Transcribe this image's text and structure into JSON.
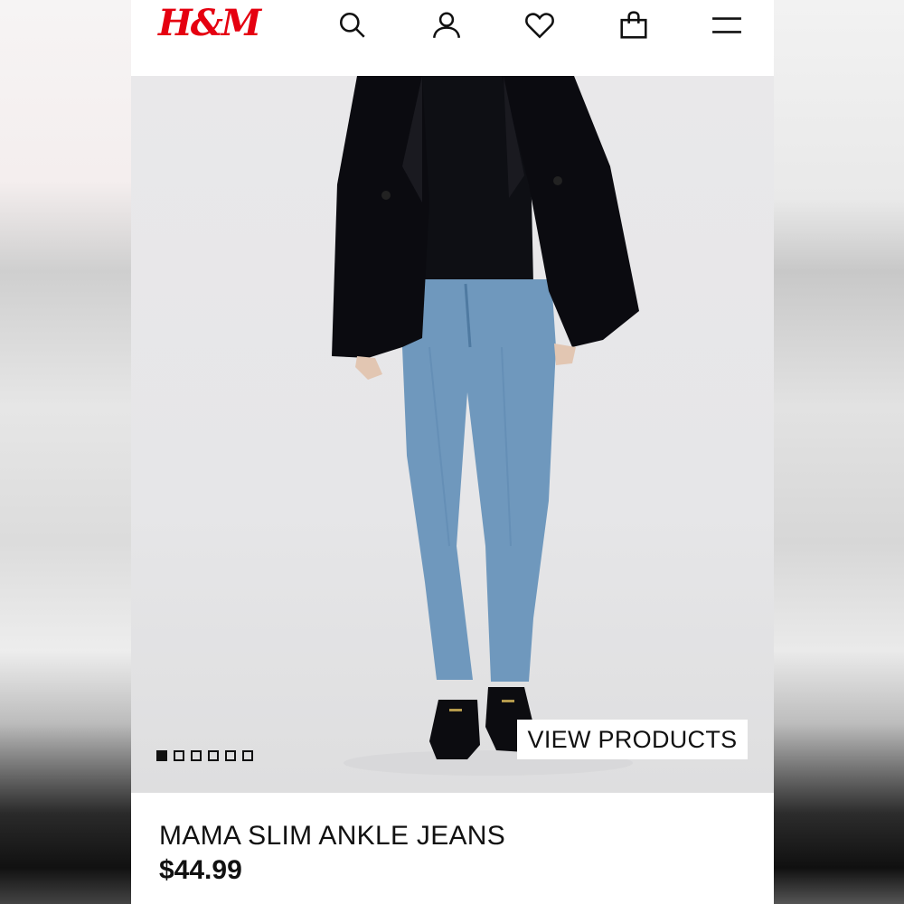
{
  "brand": {
    "logo_text": "H&M",
    "color": "#e50010"
  },
  "header": {
    "icons": [
      "search-icon",
      "account-icon",
      "favorites-icon",
      "shopping-bag-icon",
      "menu-icon"
    ]
  },
  "hero": {
    "carousel_total": 6,
    "carousel_active_index": 0,
    "cta_label": "VIEW PRODUCTS"
  },
  "product": {
    "name": "MAMA SLIM ANKLE JEANS",
    "price": "$44.99"
  }
}
